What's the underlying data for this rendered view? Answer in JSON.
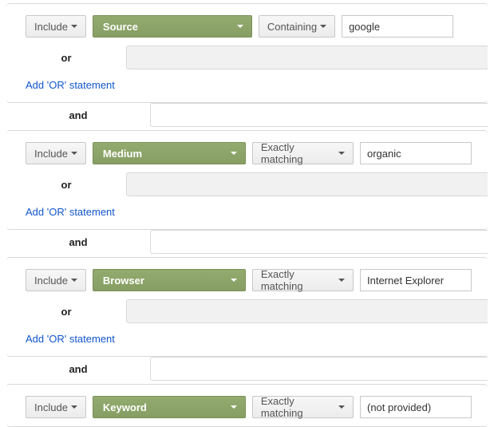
{
  "labels": {
    "include": "Include",
    "or": "or",
    "and": "and",
    "add_or": "Add 'OR' statement"
  },
  "groups": [
    {
      "dimension": "Source",
      "match_type": "Containing",
      "value": "google",
      "show_or": true,
      "show_add_or": true
    },
    {
      "dimension": "Medium",
      "match_type": "Exactly matching",
      "value": "organic",
      "show_or": true,
      "show_add_or": true
    },
    {
      "dimension": "Browser",
      "match_type": "Exactly matching",
      "value": "Internet Explorer",
      "show_or": true,
      "show_add_or": true
    },
    {
      "dimension": "Keyword",
      "match_type": "Exactly matching",
      "value": "(not provided)",
      "show_or": false,
      "show_add_or": false
    }
  ]
}
